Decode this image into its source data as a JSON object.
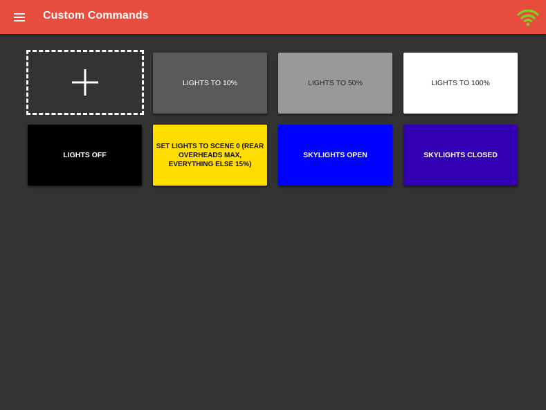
{
  "app_bar": {
    "title": "Custom Commands",
    "background_color": "#e84c3d",
    "menu_icon": "hamburger-menu-icon",
    "status_icon": "wifi-connected-icon",
    "status_icon_color": "#7ed321"
  },
  "add_tile": {
    "icon": "plus-icon"
  },
  "commands": [
    {
      "label": "LIGHTS TO 10%",
      "background": "#595959",
      "text_color": "#ffffff"
    },
    {
      "label": "LIGHTS TO 50%",
      "background": "#999999",
      "text_color": "#222222"
    },
    {
      "label": "LIGHTS TO 100%",
      "background": "#ffffff",
      "text_color": "#222222"
    },
    {
      "label": "LIGHTS OFF",
      "background": "#000000",
      "text_color": "#ffffff"
    },
    {
      "label": "SET LIGHTS TO SCENE 0 (REAR OVERHEADS MAX, EVERYTHING ELSE 15%)",
      "background": "#ffdd00",
      "text_color": "#111111"
    },
    {
      "label": "SKYLIGHTS OPEN",
      "background": "#0000ff",
      "text_color": "#ffffff"
    },
    {
      "label": "SKYLIGHTS CLOSED",
      "background": "#3300b3",
      "text_color": "#ffffff"
    }
  ]
}
